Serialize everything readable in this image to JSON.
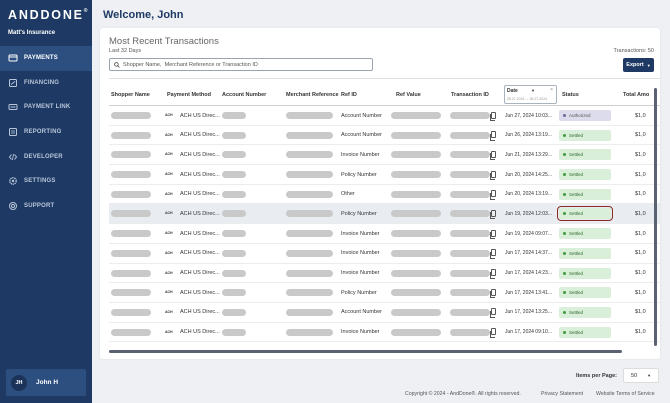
{
  "brand": {
    "logo_text": "ANDDONE",
    "trademark": "®",
    "org_name": "Matt's Insurance"
  },
  "nav": [
    {
      "label": "PAYMENTS",
      "icon": "payments-icon",
      "active": true
    },
    {
      "label": "FINANCING",
      "icon": "financing-icon",
      "active": false
    },
    {
      "label": "PAYMENT LINK",
      "icon": "payment-link-icon",
      "active": false
    },
    {
      "label": "REPORTING",
      "icon": "reporting-icon",
      "active": false
    },
    {
      "label": "DEVELOPER",
      "icon": "developer-icon",
      "active": false
    },
    {
      "label": "SETTINGS",
      "icon": "settings-icon",
      "active": false
    },
    {
      "label": "SUPPORT",
      "icon": "support-icon",
      "active": false
    }
  ],
  "user": {
    "initials": "JH",
    "name": "John H"
  },
  "header": {
    "welcome": "Welcome, John"
  },
  "card": {
    "title": "Most Recent Transactions",
    "subtitle": "Last 32 Days",
    "tx_count": "Transactions: 50",
    "search_placeholder": "Shopper Name,  Merchant Reference or Transaction ID",
    "export_label": "Export"
  },
  "table": {
    "columns": [
      "Shopper Name",
      "Payment Method",
      "Account Number",
      "Merchant Reference",
      "Ref ID",
      "Ref Value",
      "Transaction ID",
      "Status",
      "Total Amo"
    ],
    "date_filter": {
      "label": "Date",
      "range": "05-27-2024 → 06-27-2024"
    },
    "payment_badge": "ACH",
    "rows": [
      {
        "method": "ACH US Direc...",
        "ref_id": "Account Number",
        "date": "Jun 27, 2024 10:03...",
        "status": "Authorized",
        "amount": "$1,0"
      },
      {
        "method": "ACH US Direc...",
        "ref_id": "Account Number",
        "date": "Jun 26, 2024 13:19...",
        "status": "Settled",
        "amount": "$1,0"
      },
      {
        "method": "ACH US Direc...",
        "ref_id": "Invoice Number",
        "date": "Jun 21, 2024 13:29...",
        "status": "Settled",
        "amount": "$1,0"
      },
      {
        "method": "ACH US Direc...",
        "ref_id": "Policy Number",
        "date": "Jun 20, 2024 14:25...",
        "status": "Settled",
        "amount": "$1,0"
      },
      {
        "method": "ACH US Direc...",
        "ref_id": "Other",
        "date": "Jun 20, 2024 13:19...",
        "status": "Settled",
        "amount": "$1,0"
      },
      {
        "method": "ACH US Direc...",
        "ref_id": "Policy Number",
        "date": "Jun 19, 2024 12:03...",
        "status": "Settled",
        "amount": "$1,0"
      },
      {
        "method": "ACH US Direc...",
        "ref_id": "Invoice Number",
        "date": "Jun 19, 2024 09:07...",
        "status": "Settled",
        "amount": "$1,0"
      },
      {
        "method": "ACH US Direc...",
        "ref_id": "Invoice Number",
        "date": "Jun 17, 2024 14:37...",
        "status": "Settled",
        "amount": "$1,0"
      },
      {
        "method": "ACH US Direc...",
        "ref_id": "Invoice Number",
        "date": "Jun 17, 2024 14:23...",
        "status": "Settled",
        "amount": "$1,0"
      },
      {
        "method": "ACH US Direc...",
        "ref_id": "Policy Number",
        "date": "Jun 17, 2024 13:41...",
        "status": "Settled",
        "amount": "$1,0"
      },
      {
        "method": "ACH US Direc...",
        "ref_id": "Account Number",
        "date": "Jun 17, 2024 13:25...",
        "status": "Settled",
        "amount": "$1,0"
      },
      {
        "method": "ACH US Direc...",
        "ref_id": "Invoice Number",
        "date": "Jun 17, 2024 09:10...",
        "status": "Settled",
        "amount": "$1,0"
      }
    ]
  },
  "pagination": {
    "label": "Items per Page:",
    "value": "50"
  },
  "footer": {
    "copyright": "Copyright © 2024 - AndDone®. All rights reserved.",
    "privacy": "Privacy Statement",
    "terms": "Website Terms of Service"
  },
  "colors": {
    "sidebar": "#1e3a64",
    "active_nav": "#2d4f80",
    "settled_bg": "#d9efd9",
    "authorized_bg": "#dcdcec",
    "highlight_outline": "#8a2a22"
  }
}
